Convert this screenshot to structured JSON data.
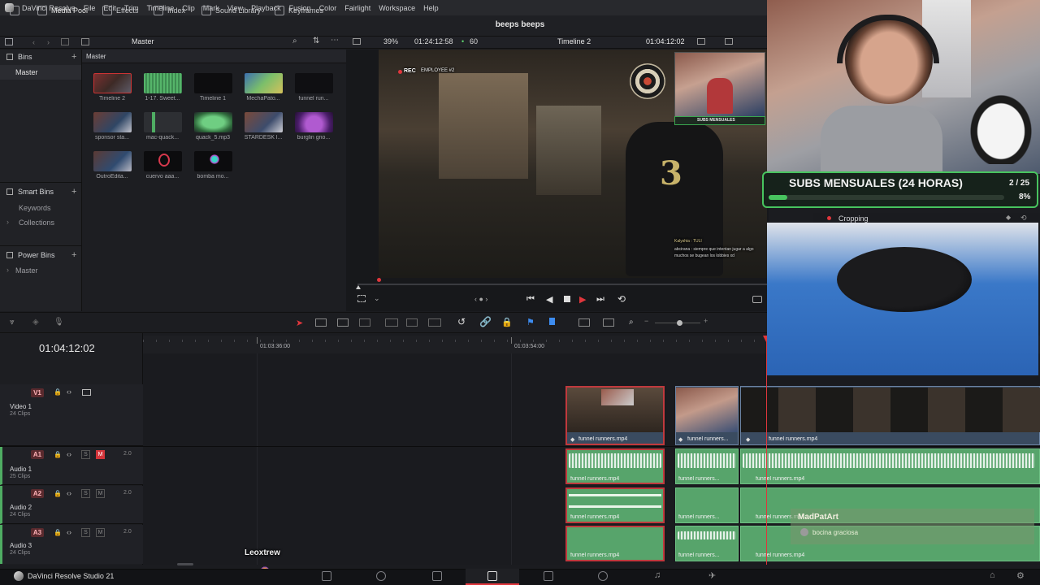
{
  "menubar": {
    "app_name": "DaVinci Resolve",
    "items": [
      "File",
      "Edit",
      "Trim",
      "Timeline",
      "Clip",
      "Mark",
      "View",
      "Playback",
      "Fusion",
      "Color",
      "Fairlight",
      "Workspace",
      "Help"
    ]
  },
  "toolbar": {
    "media_pool": "Media Pool",
    "effects": "Effects",
    "index": "Index",
    "sound_library": "Sound Library",
    "keyframes": "Keyframes",
    "project_title": "beeps beeps"
  },
  "subbar": {
    "bin_path": "Master",
    "zoom": "39%",
    "source_timecode": "01:24:12:58",
    "fps": "60",
    "timeline_name": "Timeline 2",
    "record_timecode": "01:04:12:02"
  },
  "bins": {
    "title": "Bins",
    "master": "Master",
    "smart_bins": "Smart Bins",
    "smart_items": [
      "Keywords",
      "Collections"
    ],
    "power_bins": "Power Bins",
    "power_items": [
      "Master"
    ]
  },
  "media_pool": {
    "header": "Master",
    "clips": [
      {
        "label": "Timeline 2"
      },
      {
        "label": "1-17. Sweet..."
      },
      {
        "label": "Timeline 1"
      },
      {
        "label": "MechaPato..."
      },
      {
        "label": "funnel run..."
      },
      {
        "label": "sponsor sta..."
      },
      {
        "label": "mac-quack..."
      },
      {
        "label": "quack_5.mp3"
      },
      {
        "label": "STARDESK l..."
      },
      {
        "label": "burglin gno..."
      },
      {
        "label": "OutroEdita..."
      },
      {
        "label": "cuervo aaa..."
      },
      {
        "label": "bomba mo..."
      }
    ]
  },
  "viewer": {
    "hud_rec": "REC",
    "hud_employee": "EMPLOYEE #2",
    "subs_banner": "SUBS MENSUALES",
    "chat_lines": [
      "Kalyshia : TULI",
      "abcirana : siempre que intentan jugar a algo",
      "muchos se bugean los lobbies xd"
    ]
  },
  "timeline": {
    "timecode": "01:04:12:02",
    "ruler_marks": [
      "01:03:36:00",
      "01:03:54:00"
    ],
    "tracks": [
      {
        "id": "V1",
        "name": "Video 1",
        "clips": "24 Clips"
      },
      {
        "id": "A1",
        "name": "Audio 1",
        "clips": "25 Clips",
        "level": "2.0"
      },
      {
        "id": "A2",
        "name": "Audio 2",
        "clips": "24 Clips",
        "level": "2.0"
      },
      {
        "id": "A3",
        "name": "Audio 3",
        "clips": "24 Clips",
        "level": "2.0"
      }
    ],
    "clip_name": "funnel runners.mp4",
    "clip_name_short": "funnel runners..."
  },
  "overlay": {
    "subs_title": "SUBS MENSUALES (24 HORAS)",
    "subs_count": "2 / 25",
    "subs_percent": "8%",
    "subs_progress": 0.08,
    "cropping": "Cropping",
    "chat_user": "MadPatArt",
    "chat_message": "bocina graciosa",
    "viewer_name": "Leoxtrew"
  },
  "pagebar": {
    "app_name": "DaVinci Resolve Studio 21"
  },
  "colors": {
    "accent_red": "#e0363c",
    "clip_green": "#57a46b",
    "clip_blue": "#3a4b60",
    "subs_green": "#48c45f"
  }
}
